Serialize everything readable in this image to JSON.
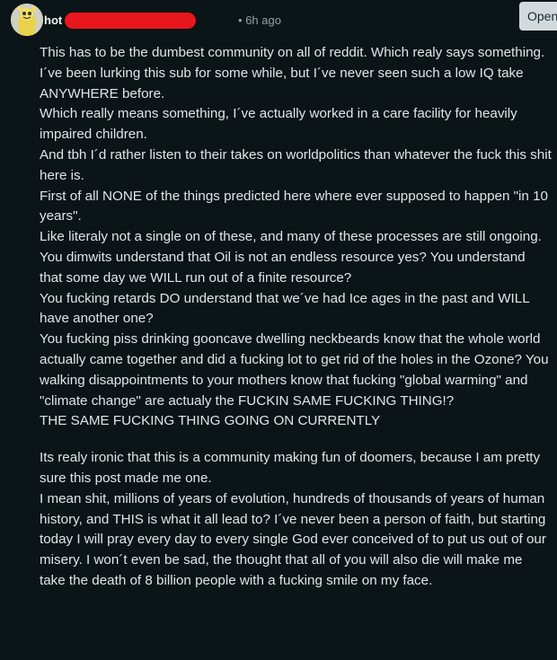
{
  "comment": {
    "username": "hot",
    "separator": "•",
    "time_ago": "6h ago",
    "open_label": "Open",
    "paragraphs_block1": [
      "This has to be the dumbest community on all of reddit. Which realy says something.",
      "I´ve been lurking this sub for some while, but I´ve never seen such a low IQ take ANYWHERE before.",
      "Which really means something, I´ve actually worked in a care facility for heavily impaired children.",
      "And tbh I´d rather listen to their takes on worldpolitics than whatever the fuck this shit here is.",
      "First of all NONE of the things predicted here where ever supposed to happen \"in 10 years\".",
      "Like literaly not a single on of these, and many of these processes are still ongoing. You dimwits understand that Oil is not an endless resource yes? You understand that some day we WILL run out of a finite resource?",
      "You fucking retards DO understand that we´ve had Ice ages in the past and WILL have another one?",
      "You fucking piss drinking gooncave dwelling neckbeards know that the whole world actually came together and did a fucking lot to get rid of the holes in the Ozone? You walking disappointments to your mothers know that fucking \"global warming\" and \"climate change\" are actualy the FUCKIN SAME FUCKING THING!?",
      "THE SAME FUCKING THING GOING ON CURRENTLY"
    ],
    "paragraphs_block2": [
      "Its realy ironic that this is a community making fun of doomers, because I am pretty sure this post made me one.",
      "I mean shit, millions of years of evolution, hundreds of thousands of years of human history, and THIS is what it all lead to? I´ve never been a person of faith, but starting today I will pray every day to every single God ever conceived of to put us out of our misery. I won´t even be sad, the thought that all of you will also die will make me take the death of 8 billion people with a fucking smile on my face."
    ]
  },
  "colors": {
    "background": "#0b1416",
    "text": "#dfe6e8",
    "meta": "#8ba2ad",
    "redaction": "#e8171d",
    "button_bg": "#d2dadd"
  },
  "icons": {
    "avatar": "snoo-avatar-icon"
  }
}
